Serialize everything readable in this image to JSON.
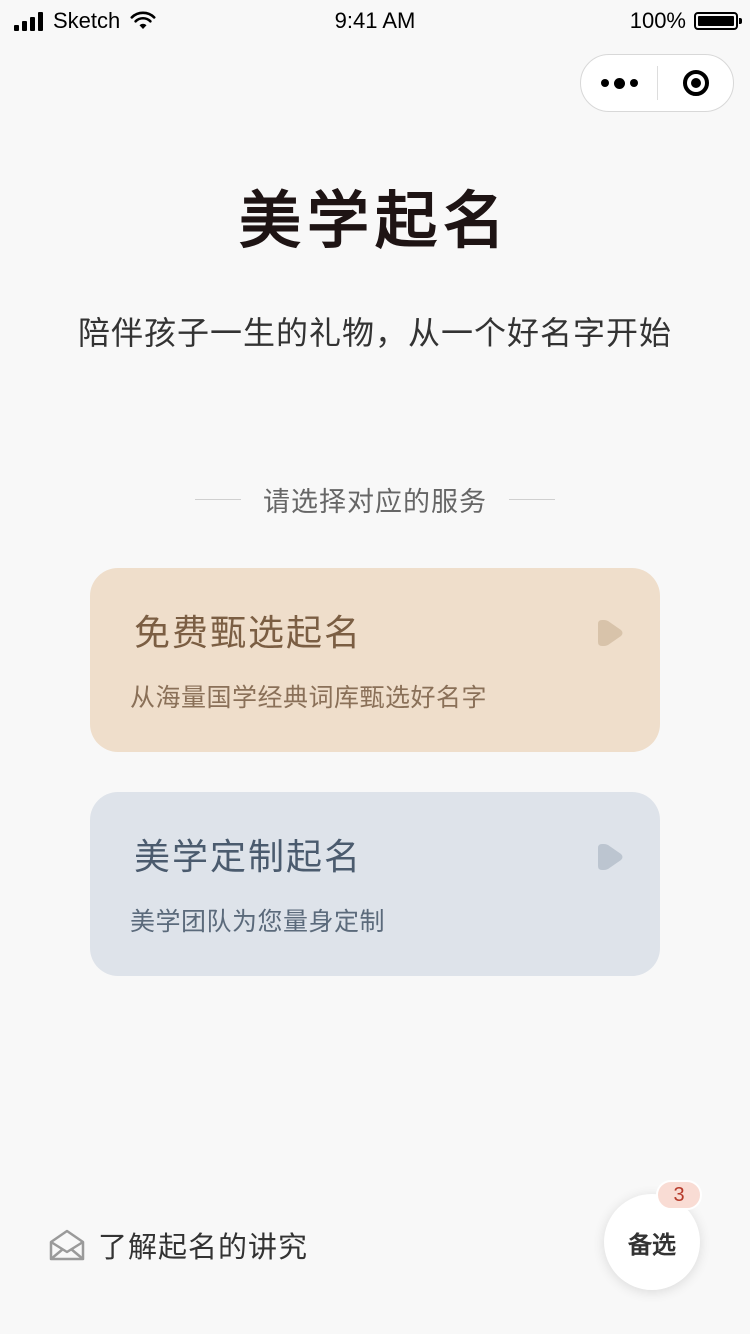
{
  "status_bar": {
    "carrier": "Sketch",
    "time": "9:41 AM",
    "battery": "100%"
  },
  "header": {
    "title": "美学起名",
    "subtitle": "陪伴孩子一生的礼物，从一个好名字开始"
  },
  "section": {
    "label": "请选择对应的服务"
  },
  "cards": [
    {
      "title": "免费甄选起名",
      "description": "从海量国学经典词库甄选好名字",
      "bg_color": "#efdecb",
      "icon": "play-icon"
    },
    {
      "title": "美学定制起名",
      "description": "美学团队为您量身定制",
      "bg_color": "#dee3ea",
      "icon": "play-icon"
    }
  ],
  "footer": {
    "learn_label": "了解起名的讲究",
    "learn_icon": "envelope-icon",
    "candidate_label": "备选",
    "candidate_count": "3"
  }
}
